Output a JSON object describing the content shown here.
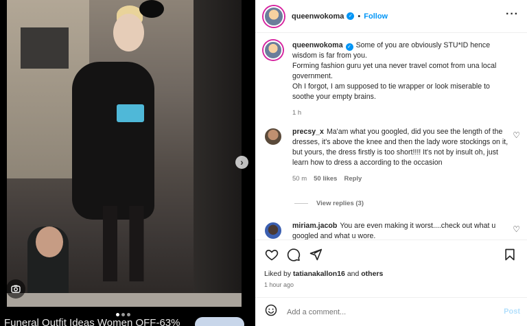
{
  "media": {
    "ad_text": "Funeral Outfit Ideas Women OFF-63%",
    "next_icon": "chevron-right-icon",
    "camera_icon": "camera-icon",
    "dot_count": 3,
    "active_dot": 1
  },
  "header": {
    "username": "queenwokoma",
    "separator": "•",
    "follow_label": "Follow",
    "more_label": "···"
  },
  "caption": {
    "username": "queenwokoma",
    "text": "Some of you are obviously STU*ID hence wisdom is far from you.\nForming fashion guru yet una never travel comot from una local government.\nOh I forgot, I am supposed to tie wrapper or look miserable to soothe your empty brains.",
    "time": "1 h"
  },
  "comments": [
    {
      "username": "precsy_x",
      "text": "Ma'am what you googled, did you see the length of the dresses, it's above the knee and then the lady wore stockings on it, but yours, the dress firstly is too short!!!! It's not by insult oh, just learn how to dress a according to the occasion",
      "time": "50 m",
      "likes": "50 likes",
      "reply_label": "Reply",
      "view_replies": "View replies (3)"
    },
    {
      "username": "miriam.jacob",
      "text": "You are even making it worst....check out what u googled and what u wore."
    }
  ],
  "actions": {
    "like_icon": "heart-icon",
    "comment_icon": "comment-icon",
    "share_icon": "share-icon",
    "save_icon": "bookmark-icon"
  },
  "likes": {
    "prefix": "Liked by ",
    "user": "tatianakallon16",
    "middle": " and ",
    "others": "others"
  },
  "time_ago": "1 hour ago",
  "comment_box": {
    "placeholder": "Add a comment...",
    "post_label": "Post",
    "emoji_icon": "emoji-icon"
  },
  "colors": {
    "accent": "#0095f6",
    "post_disabled": "#b2dffc",
    "text": "#262626",
    "secondary": "#737373"
  }
}
